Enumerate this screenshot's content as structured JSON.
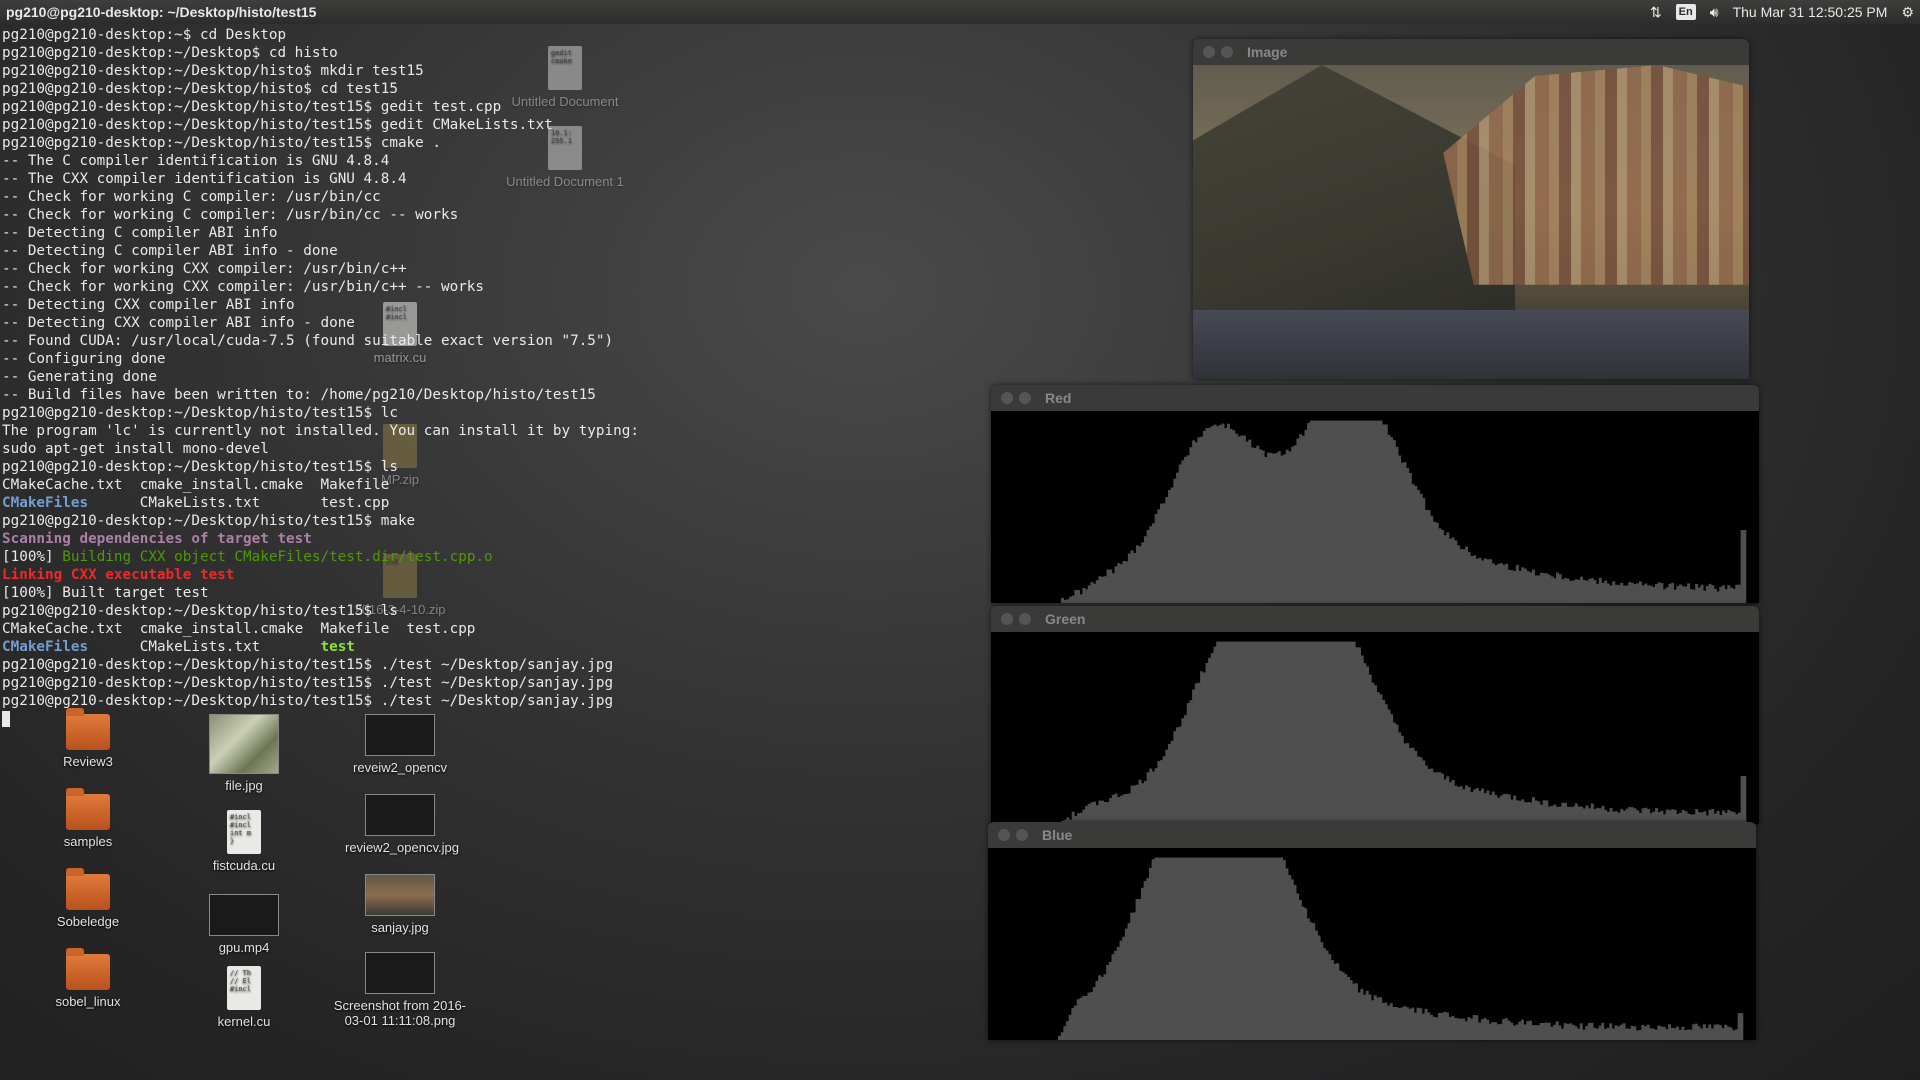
{
  "panel": {
    "title": "pg210@pg210-desktop: ~/Desktop/histo/test15",
    "lang": "En",
    "datetime": "Thu Mar 31 12:50:25 PM",
    "icons": [
      "network-arrows-icon",
      "volume-icon",
      "gear-icon"
    ]
  },
  "terminal": {
    "lines": [
      [
        {
          "t": "pg210@pg210-desktop:~$ cd Desktop"
        }
      ],
      [
        {
          "t": "pg210@pg210-desktop:~/Desktop$ cd histo"
        }
      ],
      [
        {
          "t": "pg210@pg210-desktop:~/Desktop/histo$ mkdir test15"
        }
      ],
      [
        {
          "t": "pg210@pg210-desktop:~/Desktop/histo$ cd test15"
        }
      ],
      [
        {
          "t": "pg210@pg210-desktop:~/Desktop/histo/test15$ gedit test.cpp"
        }
      ],
      [
        {
          "t": "pg210@pg210-desktop:~/Desktop/histo/test15$ gedit CMakeLists.txt"
        }
      ],
      [
        {
          "t": "pg210@pg210-desktop:~/Desktop/histo/test15$ cmake ."
        }
      ],
      [
        {
          "t": "-- The C compiler identification is GNU 4.8.4"
        }
      ],
      [
        {
          "t": "-- The CXX compiler identification is GNU 4.8.4"
        }
      ],
      [
        {
          "t": "-- Check for working C compiler: /usr/bin/cc"
        }
      ],
      [
        {
          "t": "-- Check for working C compiler: /usr/bin/cc -- works"
        }
      ],
      [
        {
          "t": "-- Detecting C compiler ABI info"
        }
      ],
      [
        {
          "t": "-- Detecting C compiler ABI info - done"
        }
      ],
      [
        {
          "t": "-- Check for working CXX compiler: /usr/bin/c++"
        }
      ],
      [
        {
          "t": "-- Check for working CXX compiler: /usr/bin/c++ -- works"
        }
      ],
      [
        {
          "t": "-- Detecting CXX compiler ABI info"
        }
      ],
      [
        {
          "t": "-- Detecting CXX compiler ABI info - done"
        }
      ],
      [
        {
          "t": "-- Found CUDA: /usr/local/cuda-7.5 (found suitable exact version \"7.5\")"
        }
      ],
      [
        {
          "t": "-- Configuring done"
        }
      ],
      [
        {
          "t": "-- Generating done"
        }
      ],
      [
        {
          "t": "-- Build files have been written to: /home/pg210/Desktop/histo/test15"
        }
      ],
      [
        {
          "t": "pg210@pg210-desktop:~/Desktop/histo/test15$ lc"
        }
      ],
      [
        {
          "t": "The program 'lc' is currently not installed. You can install it by typing:"
        }
      ],
      [
        {
          "t": "sudo apt-get install mono-devel"
        }
      ],
      [
        {
          "t": "pg210@pg210-desktop:~/Desktop/histo/test15$ ls"
        }
      ],
      [
        {
          "t": "CMakeCache.txt  cmake_install.cmake  Makefile"
        }
      ],
      [
        {
          "t": "CMakeFiles",
          "c": "c-dir"
        },
        {
          "t": "      CMakeLists.txt       test.cpp"
        }
      ],
      [
        {
          "t": "pg210@pg210-desktop:~/Desktop/histo/test15$ make"
        }
      ],
      [
        {
          "t": "Scanning dependencies of target test",
          "c": "c-magenta"
        }
      ],
      [
        {
          "t": "[100%] "
        },
        {
          "t": "Building CXX object CMakeFiles/test.dir/test.cpp.o",
          "c": "c-green"
        }
      ],
      [
        {
          "t": "Linking CXX executable test",
          "c": "c-red"
        }
      ],
      [
        {
          "t": "[100%] Built target test"
        }
      ],
      [
        {
          "t": "pg210@pg210-desktop:~/Desktop/histo/test15$ ls"
        }
      ],
      [
        {
          "t": "CMakeCache.txt  cmake_install.cmake  Makefile  test.cpp"
        }
      ],
      [
        {
          "t": "CMakeFiles",
          "c": "c-dir"
        },
        {
          "t": "      CMakeLists.txt       "
        },
        {
          "t": "test",
          "c": "c-exec"
        }
      ],
      [
        {
          "t": "pg210@pg210-desktop:~/Desktop/histo/test15$ ./test ~/Desktop/sanjay.jpg"
        }
      ],
      [
        {
          "t": "pg210@pg210-desktop:~/Desktop/histo/test15$ ./test ~/Desktop/sanjay.jpg"
        }
      ],
      [
        {
          "t": "pg210@pg210-desktop:~/Desktop/histo/test15$ ./test ~/Desktop/sanjay.jpg"
        }
      ]
    ]
  },
  "desktop_icons": [
    {
      "label": "Review3",
      "kind": "folder"
    },
    {
      "label": "samples",
      "kind": "folder"
    },
    {
      "label": "Sobeledge",
      "kind": "folder"
    },
    {
      "label": "sobel_linux",
      "kind": "folder"
    },
    {
      "label": "file.jpg",
      "kind": "plant"
    },
    {
      "label": "fistcuda.cu",
      "kind": "file",
      "glyph": "#incl\n#incl\nint m\n}"
    },
    {
      "label": "gpu.mp4",
      "kind": "screen"
    },
    {
      "label": "kernel.cu",
      "kind": "file",
      "glyph": "// Th\n// El\n\n#incl"
    },
    {
      "label": "reveiw2_opencv",
      "kind": "screen"
    },
    {
      "label": "review2_opencv.jpg",
      "kind": "screen"
    },
    {
      "label": "sanjay.jpg",
      "kind": "photo"
    },
    {
      "label": "Screenshot from 2016-03-01 11:11:08.png",
      "kind": "screen"
    },
    {
      "label": "Untitled Document",
      "kind": "file",
      "glyph": "gedit\n\n\ncmake"
    },
    {
      "label": "Untitled Document 1",
      "kind": "file",
      "glyph": "10.1:\n255.1"
    },
    {
      "label": "matrix.cu",
      "kind": "file",
      "glyph": "#incl\n#incl"
    },
    {
      "label": "MP.zip",
      "kind": "file",
      "glyph": ""
    },
    {
      "label": "2016-3-4-10.zip",
      "kind": "file",
      "glyph": "zip"
    }
  ],
  "windows": {
    "image": {
      "title": "Image"
    },
    "red": {
      "title": "Red",
      "color": "#4f4f4f"
    },
    "green": {
      "title": "Green",
      "color": "#4f4f4f"
    },
    "blue": {
      "title": "Blue",
      "color": "#4f4f4f"
    }
  },
  "histograms": {
    "red": {
      "rise": 0.06,
      "peak1": 0.22,
      "peak2": 0.42,
      "spread": 0.55,
      "tail": 0.06,
      "spike": 0.38
    },
    "green": {
      "rise": 0.05,
      "peak1": 0.25,
      "peak2": 0.38,
      "spread": 0.55,
      "tail": 0.04,
      "spike": 0.25
    },
    "blue": {
      "rise": 0.02,
      "peak1": 0.17,
      "peak2": 0.28,
      "spread": 0.45,
      "tail": 0.05,
      "spike": 0.14
    }
  }
}
